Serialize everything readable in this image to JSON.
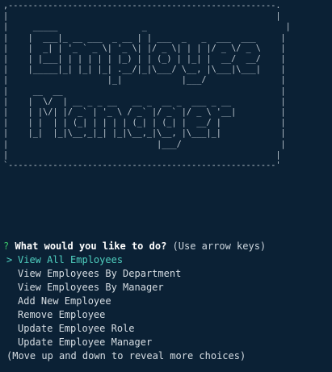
{
  "banner": {
    "art": ",------------------------------------------------------.\n|                                                      |\n|     _____                 _                            |\n|    |  ___|_ __ ___  _ __ | | ___  _   _  ___  ___     |\n|    |  _| | '_ ` _ \\| '_ \\| |/ _ \\| | | |/ _ \\/ _ \\    |\n|    | |___| | | | | | |_) | | (_) | |_| |  __/  __/    |\n|    |_____|_| |_| |_| .__/|_|\\___/ \\__, |\\___|\\___|    |\n|                    |_|            |___/               |\n|     __  __                                            |\n|    |  \\/  | __ _ _ __   __ _  __ _  ___ _ __          |\n|    | |\\/| |/ _` | '_ \\ / _` |/ _` |/ _ \\ '__|         |\n|    | |  | | (_| | | | | (_| | (_| |  __/ |            |\n|    |_|  |_|\\__,_|_| |_|\\__,_|\\__, |\\___|_|            |\n|                              |___/                    |\n|                                                      |\n`------------------------------------------------------'"
  },
  "prompt": {
    "mark": "?",
    "question": "What would you like to do?",
    "hint": "(Use arrow keys)"
  },
  "pointer": ">",
  "choices": [
    {
      "label": "View All Employees",
      "selected": true
    },
    {
      "label": "View Employees By Department",
      "selected": false
    },
    {
      "label": "View Employees By Manager",
      "selected": false
    },
    {
      "label": "Add New Employee",
      "selected": false
    },
    {
      "label": "Remove Employee",
      "selected": false
    },
    {
      "label": "Update Employee Role",
      "selected": false
    },
    {
      "label": "Update Employee Manager",
      "selected": false
    }
  ],
  "footer": "(Move up and down to reveal more choices)",
  "colors": {
    "background": "#0b2135",
    "question_mark": "#39c46a",
    "selected": "#4fd0c0"
  }
}
